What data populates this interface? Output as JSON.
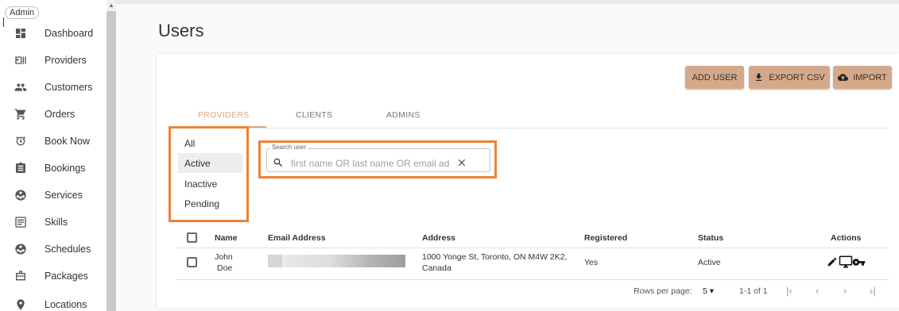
{
  "admin_badge": "Admin",
  "sidebar": {
    "items": [
      {
        "label": "Dashboard",
        "icon": "dashboard-icon"
      },
      {
        "label": "Providers",
        "icon": "badge-icon"
      },
      {
        "label": "Customers",
        "icon": "people-icon"
      },
      {
        "label": "Orders",
        "icon": "cart-icon"
      },
      {
        "label": "Book Now",
        "icon": "alarm-icon"
      },
      {
        "label": "Bookings",
        "icon": "clipboard-icon"
      },
      {
        "label": "Services",
        "icon": "services-icon"
      },
      {
        "label": "Skills",
        "icon": "list-icon"
      },
      {
        "label": "Schedules",
        "icon": "schedule-icon"
      },
      {
        "label": "Packages",
        "icon": "package-icon"
      },
      {
        "label": "Locations",
        "icon": "location-icon"
      }
    ]
  },
  "page": {
    "title": "Users"
  },
  "actions": {
    "add_user": "ADD USER",
    "export_csv": "EXPORT CSV",
    "import": "IMPORT"
  },
  "tabs": [
    {
      "label": "PROVIDERS",
      "active": true
    },
    {
      "label": "CLIENTS",
      "active": false
    },
    {
      "label": "ADMINS",
      "active": false
    }
  ],
  "filters": [
    {
      "label": "All",
      "selected": false
    },
    {
      "label": "Active",
      "selected": true
    },
    {
      "label": "Inactive",
      "selected": false
    },
    {
      "label": "Pending",
      "selected": false
    }
  ],
  "search": {
    "legend": "Search user",
    "placeholder": "first name OR last name OR email add"
  },
  "table": {
    "headers": {
      "name": "Name",
      "email": "Email Address",
      "address": "Address",
      "registered": "Registered",
      "status": "Status",
      "actions": "Actions"
    },
    "rows": [
      {
        "first": "John",
        "last": "Doe",
        "address_line1": "1000 Yonge St, Toronto, ON M4W 2K2,",
        "address_line2": "Canada",
        "registered": "Yes",
        "status": "Active"
      }
    ]
  },
  "pagination": {
    "rows_label": "Rows per page:",
    "rows_value": "5",
    "range": "1-1 of 1"
  },
  "colors": {
    "accent": "#d4a98a",
    "highlight": "#ee8233"
  }
}
